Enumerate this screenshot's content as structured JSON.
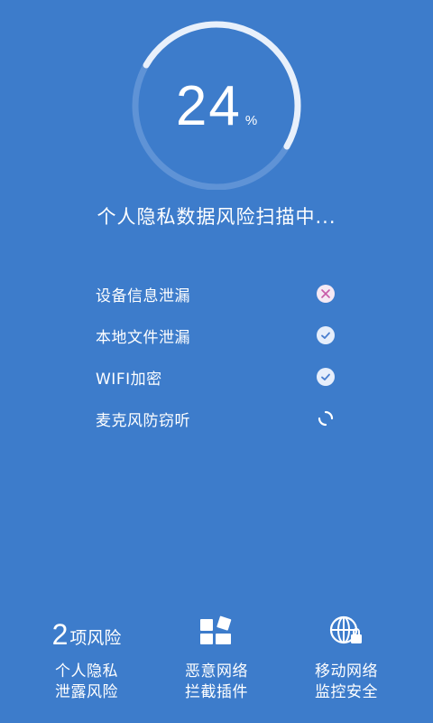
{
  "scan": {
    "progress_value": "24",
    "progress_unit": "%",
    "progress_fraction": 0.24,
    "status_text": "个人隐私数据风险扫描中..."
  },
  "checks": [
    {
      "label": "设备信息泄漏",
      "status": "fail",
      "icon": "x-circle-icon"
    },
    {
      "label": "本地文件泄漏",
      "status": "pass",
      "icon": "check-circle-icon"
    },
    {
      "label": "WIFI加密",
      "status": "pass",
      "icon": "check-circle-icon"
    },
    {
      "label": "麦克风防窃听",
      "status": "loading",
      "icon": "loading-spinner-icon"
    }
  ],
  "bottom": {
    "risk_count": "2",
    "risk_count_unit": "项风险",
    "features": [
      {
        "title_line1": "个人隐私",
        "title_line2": "泄露风险"
      },
      {
        "title_line1": "恶意网络",
        "title_line2": "拦截插件",
        "icon": "puzzle-blocks-icon"
      },
      {
        "title_line1": "移动网络",
        "title_line2": "监控安全",
        "icon": "globe-lock-icon"
      }
    ]
  },
  "colors": {
    "background": "#3d7ccb",
    "ring_track": "#5f93d6",
    "ring_progress": "#e8f0fb",
    "text": "#ffffff",
    "fail_mark": "#c85aa8",
    "pass_mark": "#4a7fcf"
  }
}
